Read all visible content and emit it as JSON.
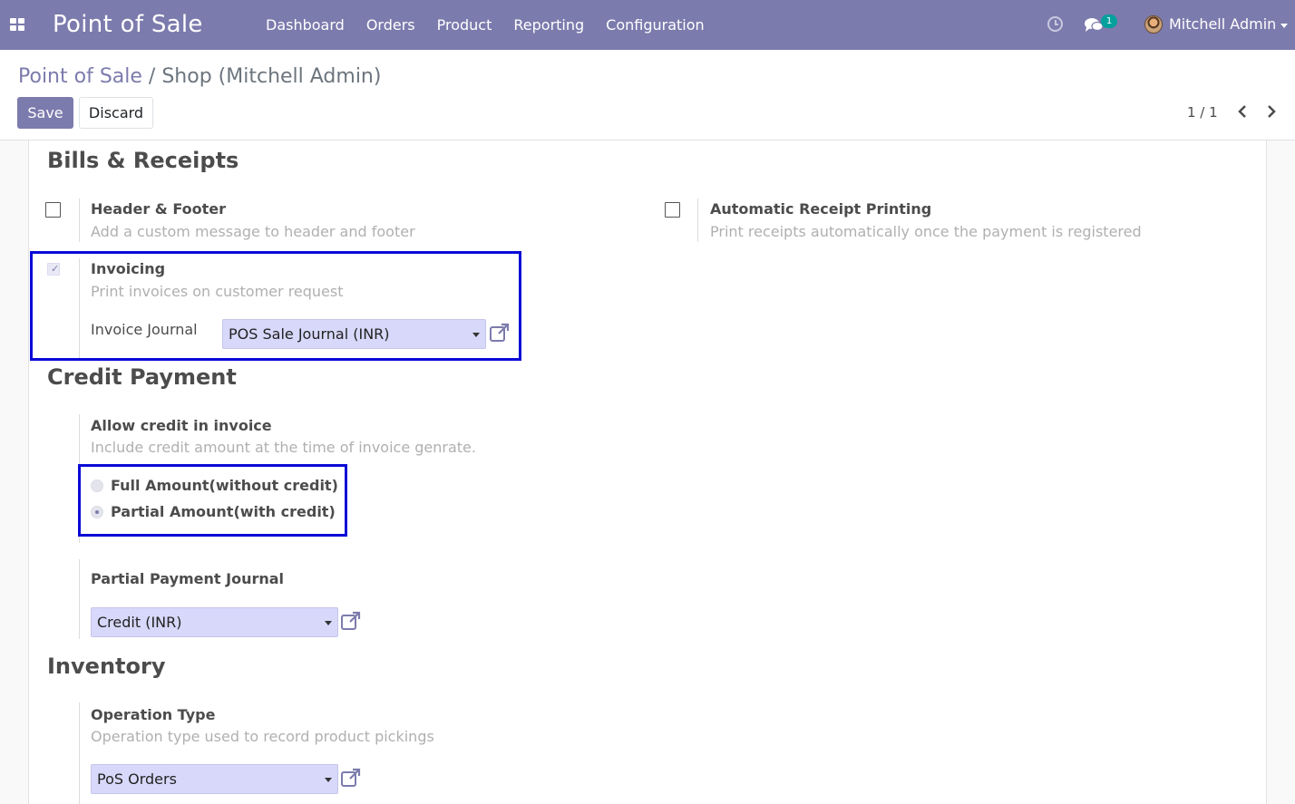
{
  "navbar": {
    "brand": "Point of Sale",
    "menu": [
      "Dashboard",
      "Orders",
      "Product",
      "Reporting",
      "Configuration"
    ],
    "chat_count": "1",
    "user": "Mitchell Admin",
    "icons": [
      "apps-grid-icon",
      "clock-icon",
      "chat-icon",
      "avatar",
      "chevron-down-icon"
    ]
  },
  "control_panel": {
    "breadcrumb_parent": "Point of Sale",
    "breadcrumb_separator": "/",
    "breadcrumb_current": "Shop (Mitchell Admin)",
    "save_label": "Save",
    "discard_label": "Discard",
    "pager": "1 / 1"
  },
  "sections": {
    "bills": {
      "title": "Bills & Receipts",
      "header_footer": {
        "label": "Header & Footer",
        "help": "Add a custom message to header and footer",
        "checked": false
      },
      "auto_print": {
        "label": "Automatic Receipt Printing",
        "help": "Print receipts automatically once the payment is registered",
        "checked": false
      },
      "invoicing": {
        "label": "Invoicing",
        "help": "Print invoices on customer request",
        "checked": true,
        "journal_label": "Invoice Journal",
        "journal_value": "POS Sale Journal (INR)"
      }
    },
    "credit": {
      "title": "Credit Payment",
      "allow_label": "Allow credit in invoice",
      "allow_help": "Include credit amount at the time of invoice genrate.",
      "option_full": "Full Amount(without credit)",
      "option_partial": "Partial Amount(with credit)",
      "selected": "partial",
      "partial_journal_label": "Partial Payment Journal",
      "partial_journal_value": "Credit (INR)"
    },
    "inventory": {
      "title": "Inventory",
      "operation_label": "Operation Type",
      "operation_help": "Operation type used to record product pickings",
      "operation_value": "PoS Orders"
    }
  },
  "colors": {
    "navbar": "#7c7bad",
    "select_bg": "#d8d8fb",
    "highlight": "#0a0ad6",
    "badge": "#00a09d"
  }
}
